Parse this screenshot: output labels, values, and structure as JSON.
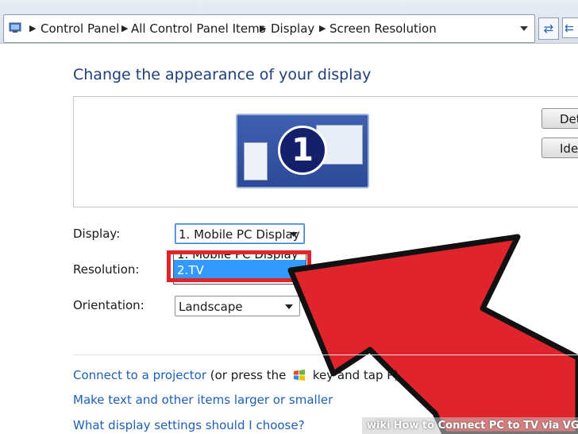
{
  "breadcrumb": {
    "items": [
      "Control Panel",
      "All Control Panel Items",
      "Display",
      "Screen Resolution"
    ]
  },
  "heading": "Change the appearance of your display",
  "preview": {
    "monitor_number": "1",
    "detect_label": "Det",
    "identify_label": "Ider"
  },
  "fields": {
    "display_label": "Display:",
    "display_value": "1. Mobile PC Display",
    "resolution_label": "Resolution:",
    "orientation_label": "Orientation:",
    "orientation_value": "Landscape"
  },
  "dropdown": {
    "options": [
      "1. Mobile PC Display",
      "2.TV"
    ],
    "selected": "2.TV"
  },
  "links": {
    "projector_link": "Connect to a projector",
    "projector_hint_before": "(or press the",
    "projector_hint_after": "key and tap P)",
    "text_size_link": "Make text and other items larger or smaller",
    "settings_link": "What display settings should I choose?"
  },
  "watermark": {
    "brand": "wiki",
    "title": "How to Connect PC to TV via VGA"
  },
  "colors": {
    "highlight": "#e0242c",
    "arrow_fill": "#e0242c",
    "link": "#1e5fb7",
    "selection": "#3399ff"
  }
}
